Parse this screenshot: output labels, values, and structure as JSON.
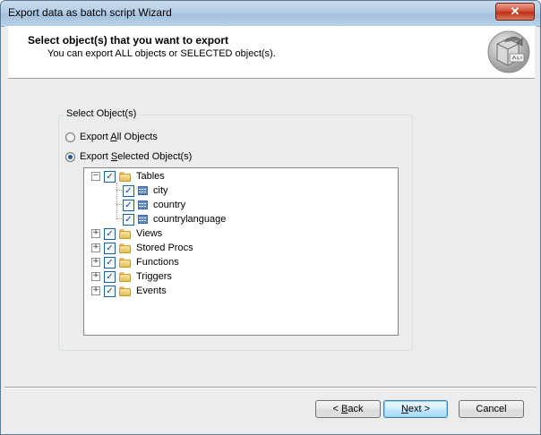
{
  "window": {
    "title": "Export data as batch script Wizard",
    "close_glyph": "✕"
  },
  "header": {
    "title": "Select object(s)  that you want to export",
    "subtitle": "You can export ALL objects or SELECTED object(s).",
    "icon": "export-sql-icon"
  },
  "group": {
    "legend": "Select Object(s)",
    "radio_all": {
      "label_pre": "Export ",
      "label_key": "A",
      "label_post": "ll Objects",
      "checked": false
    },
    "radio_selected": {
      "label_pre": "Export ",
      "label_key": "S",
      "label_post": "elected Object(s)",
      "checked": true
    }
  },
  "tree": {
    "tables": {
      "label": "Tables",
      "expander": "−",
      "checked": "✓"
    },
    "table_items": [
      {
        "label": "city",
        "checked": "✓"
      },
      {
        "label": "country",
        "checked": "✓"
      },
      {
        "label": "countrylanguage",
        "checked": "✓"
      }
    ],
    "folders": [
      {
        "label": "Views",
        "expander": "+",
        "checked": "✓"
      },
      {
        "label": "Stored Procs",
        "expander": "+",
        "checked": "✓"
      },
      {
        "label": "Functions",
        "expander": "+",
        "checked": "✓"
      },
      {
        "label": "Triggers",
        "expander": "+",
        "checked": "✓"
      },
      {
        "label": "Events",
        "expander": "+",
        "checked": "✓"
      }
    ]
  },
  "buttons": {
    "back": {
      "pre": "< ",
      "key": "B",
      "post": "ack"
    },
    "next": {
      "pre": "",
      "key": "N",
      "post": "ext >"
    },
    "cancel": "Cancel"
  },
  "colors": {
    "accent": "#1c5d9c",
    "folder": "#e3bf57"
  }
}
